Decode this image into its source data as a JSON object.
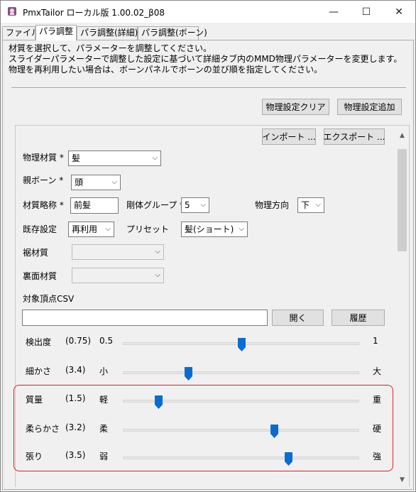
{
  "window": {
    "title": "PmxTailor ローカル版 1.00.02_β08",
    "minimize": "—",
    "maximize": "☐",
    "close": "✕"
  },
  "tabs": [
    "ファイル",
    "パラ調整",
    "パラ調整(詳細)",
    "パラ調整(ボーン)"
  ],
  "active_tab": "パラ調整",
  "description": [
    "材質を選択して、パラメーターを調整してください。",
    "スライダーパラメーターで調整した設定に基づいて詳細タブ内のMMD物理パラメーターを変更します。",
    "物理を再利用したい場合は、ボーンパネルでボーンの並び順を指定してください。"
  ],
  "buttons": {
    "clear": "物理設定クリア",
    "add": "物理設定追加",
    "import": "インポート ...",
    "export": "エクスポート ...",
    "open": "開く",
    "history": "履歴"
  },
  "form": {
    "material_label": "物理材質 *",
    "material_value": "髪",
    "parent_bone_label": "親ボーン *",
    "parent_bone_value": "頭",
    "abbrev_label": "材質略称 *",
    "abbrev_value": "前髪",
    "rigid_group_label": "剛体グループ *",
    "rigid_group_value": "5",
    "direction_label": "物理方向",
    "direction_value": "下",
    "existing_label": "既存設定",
    "existing_value": "再利用",
    "preset_label": "プリセット",
    "preset_value": "髪(ショート)",
    "hem_label": "裾材質",
    "hem_value": "",
    "back_label": "裏面材質",
    "back_value": "",
    "csv_label": "対象頂点CSV",
    "csv_value": ""
  },
  "sliders": [
    {
      "label": "検出度",
      "value_text": "(0.75)",
      "min": "0.5",
      "max": "1",
      "fraction": 0.5
    },
    {
      "label": "細かさ",
      "value_text": "(3.4)",
      "min": "小",
      "max": "大",
      "fraction": 0.275
    },
    {
      "label": "質量",
      "value_text": "(1.5)",
      "min": "軽",
      "max": "重",
      "fraction": 0.15
    },
    {
      "label": "柔らかさ",
      "value_text": "(3.2)",
      "min": "柔",
      "max": "硬",
      "fraction": 0.64
    },
    {
      "label": "張り",
      "value_text": "(3.5)",
      "min": "弱",
      "max": "強",
      "fraction": 0.7
    }
  ],
  "colors": {
    "slider_thumb": "#0a6cd1",
    "highlight": "#e02020"
  }
}
